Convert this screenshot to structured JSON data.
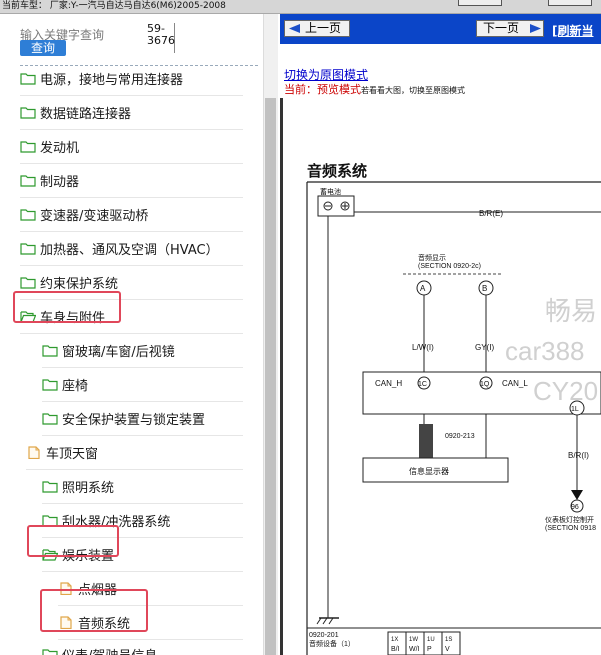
{
  "window": {
    "title": "当前车型：  厂家:Y-一汽马自达马自达6(M6)2005-2008"
  },
  "search": {
    "placeholder": "输入关键字查询",
    "button_label": "查询",
    "result_line1": "59-",
    "result_line2": "3676"
  },
  "tree": [
    {
      "label": "电源，接地与常用连接器",
      "icon": "folder-icon"
    },
    {
      "label": "数据链路连接器",
      "icon": "folder-icon"
    },
    {
      "label": "发动机",
      "icon": "folder-icon"
    },
    {
      "label": "制动器",
      "icon": "folder-icon"
    },
    {
      "label": "变速器/变速驱动桥",
      "icon": "folder-icon"
    },
    {
      "label": "加热器、通风及空调（HVAC）",
      "icon": "folder-icon"
    },
    {
      "label": "约束保护系统",
      "icon": "folder-icon"
    },
    {
      "label": "车身与附件",
      "icon": "folder-open-icon",
      "highlighted": true
    },
    {
      "label": "窗玻璃/车窗/后视镜",
      "icon": "folder-icon"
    },
    {
      "label": "座椅",
      "icon": "folder-icon"
    },
    {
      "label": "安全保护装置与锁定装置",
      "icon": "folder-icon"
    },
    {
      "label": "车顶天窗",
      "icon": "document-icon"
    },
    {
      "label": "照明系统",
      "icon": "folder-icon"
    },
    {
      "label": "刮水器/冲洗器系统",
      "icon": "folder-icon"
    },
    {
      "label": "娱乐装置",
      "icon": "folder-open-icon",
      "highlighted": true
    },
    {
      "label": "点烟器",
      "icon": "document-icon"
    },
    {
      "label": "音频系统",
      "icon": "document-icon",
      "highlighted": true,
      "selected": true
    },
    {
      "label": "仪表/驾驶员信息",
      "icon": "folder-icon"
    }
  ],
  "content": {
    "prev_label": "上一页",
    "next_label": "下一页",
    "refresh_label": "[刷新当",
    "toggle_link": "切换为原图模式",
    "current_label": "当前：",
    "current_mode": "预览模式",
    "current_hint": "若看看大图，切换至原图模式"
  },
  "diagram": {
    "title": "音频系统",
    "battery": "蓄电池",
    "wire_main": "B/R(E)",
    "display_label": "音频显示",
    "display_section": "(SECTION 0920-2c)",
    "pin_a": "A",
    "pin_b": "B",
    "wire_a": "L/W(I)",
    "wire_b": "GY(I)",
    "can_h": "CAN_H",
    "can_l": "CAN_L",
    "pin_1c": "1C",
    "pin_1q": "1Q",
    "pin_1l": "1L",
    "connector": "0920-213",
    "info_display": "信息显示器",
    "wire_br": "B/R(I)",
    "pin_96": "96",
    "panel_label": "仪表板灯控制开",
    "panel_section": "(SECTION 0918",
    "page_code": "0920-201",
    "footer": "音频设备（1）",
    "watermark1": "畅易",
    "watermark2": "car388",
    "watermark3": "CY20",
    "pin_row_top": [
      "1X",
      "1W",
      "1U",
      "1S"
    ],
    "pin_row_bot": [
      "B/I",
      "W/I",
      "P",
      "V"
    ]
  },
  "colors": {
    "nav_bar": "#0b45c8",
    "highlight_border": "#e0475a",
    "search_button": "#2e7ed6",
    "current_mode_text": "#cc0000",
    "link": "#0000cc"
  }
}
